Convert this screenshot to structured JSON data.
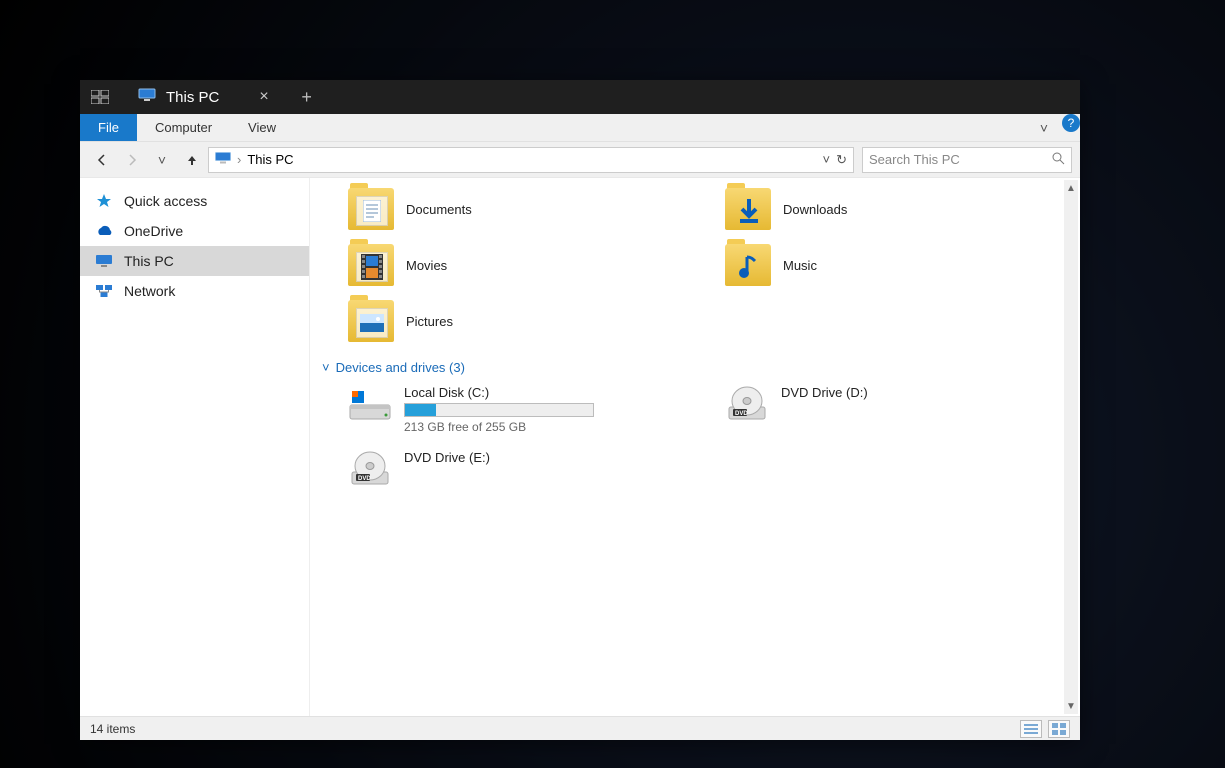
{
  "titlebar": {
    "tab_title": "This PC"
  },
  "ribbon": {
    "file": "File",
    "tabs": [
      "Computer",
      "View"
    ]
  },
  "breadcrumb": {
    "location": "This PC"
  },
  "search": {
    "placeholder": "Search This PC"
  },
  "sidebar": {
    "items": [
      {
        "label": "Quick access",
        "icon": "star"
      },
      {
        "label": "OneDrive",
        "icon": "cloud"
      },
      {
        "label": "This PC",
        "icon": "pc",
        "selected": true
      },
      {
        "label": "Network",
        "icon": "network"
      }
    ]
  },
  "folders": [
    {
      "label": "Documents",
      "kind": "documents"
    },
    {
      "label": "Downloads",
      "kind": "downloads"
    },
    {
      "label": "Movies",
      "kind": "movies"
    },
    {
      "label": "Music",
      "kind": "music"
    },
    {
      "label": "Pictures",
      "kind": "pictures"
    }
  ],
  "devices_section": {
    "title": "Devices and drives (3)"
  },
  "drives": [
    {
      "label": "Local Disk (C:)",
      "free_text": "213 GB free of 255 GB",
      "used_fraction": 0.165,
      "kind": "hdd"
    },
    {
      "label": "DVD Drive (D:)",
      "kind": "dvd"
    },
    {
      "label": "DVD Drive (E:)",
      "kind": "dvd"
    }
  ],
  "statusbar": {
    "item_count": "14 items"
  }
}
